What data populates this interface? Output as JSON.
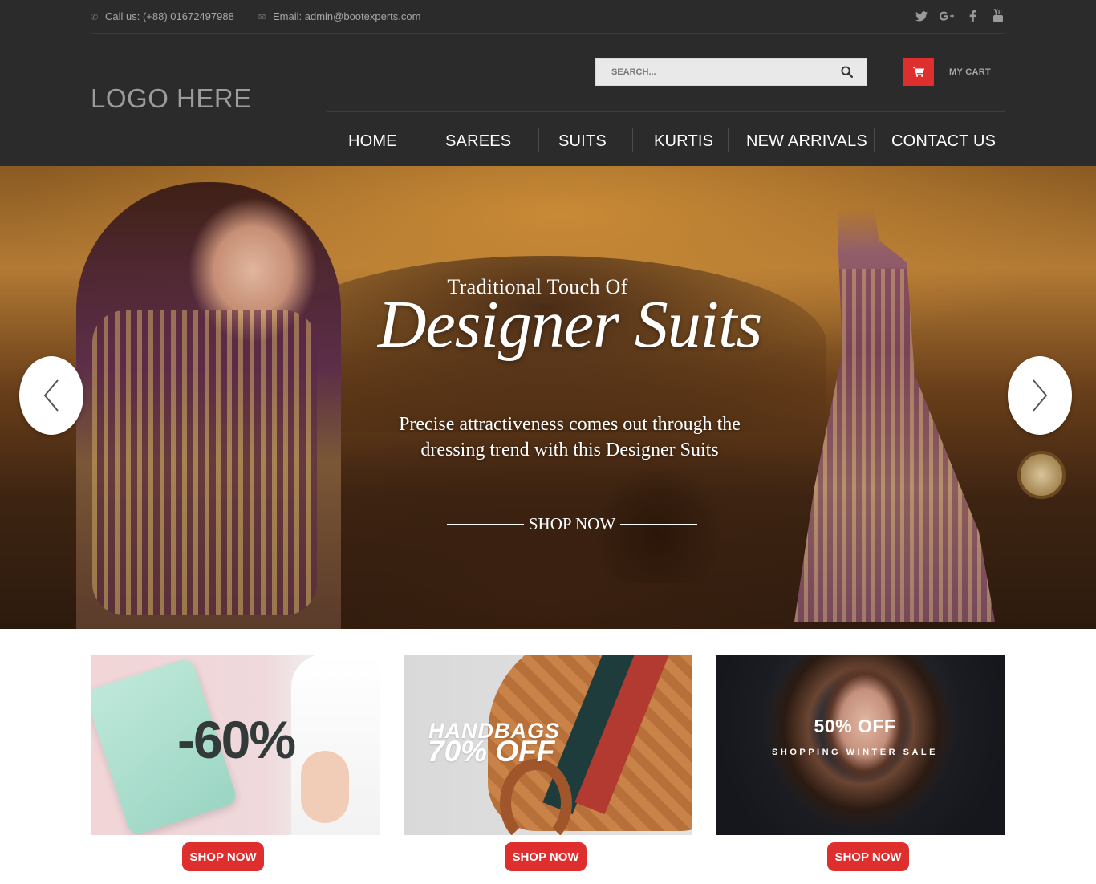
{
  "topbar": {
    "phone": "Call us: (+88) 01672497988",
    "email": "Email: admin@bootexperts.com",
    "social_icons": [
      "twitter-icon",
      "google-plus-icon",
      "facebook-icon",
      "youtube-icon"
    ]
  },
  "header": {
    "logo": "LOGO HERE",
    "search_placeholder": "SEARCH...",
    "cart_label": "MY CART"
  },
  "nav": {
    "items": [
      {
        "label": "HOME"
      },
      {
        "label": "SAREES"
      },
      {
        "label": "SUITS"
      },
      {
        "label": "KURTIS"
      },
      {
        "label": "NEW ARRIVALS"
      },
      {
        "label": "CONTACT US"
      }
    ]
  },
  "hero": {
    "subtitle": "Traditional Touch Of",
    "title": "Designer Suits",
    "description_line1": "Precise attractiveness comes out through the",
    "description_line2": "dressing trend with this Designer Suits",
    "cta": "SHOP NOW"
  },
  "promos": [
    {
      "headline": "-60%",
      "cta": "SHOP NOW"
    },
    {
      "headline": "HANDBAGS",
      "subheadline": "70% OFF",
      "cta": "SHOP NOW"
    },
    {
      "headline": "50% OFF",
      "subheadline": "SHOPPING WINTER SALE",
      "cta": "SHOP NOW"
    }
  ],
  "colors": {
    "header_bg": "#2b2b2b",
    "accent_red": "#df2e2e",
    "nav_text": "#ffffff",
    "muted_text": "#a7a7a7"
  }
}
